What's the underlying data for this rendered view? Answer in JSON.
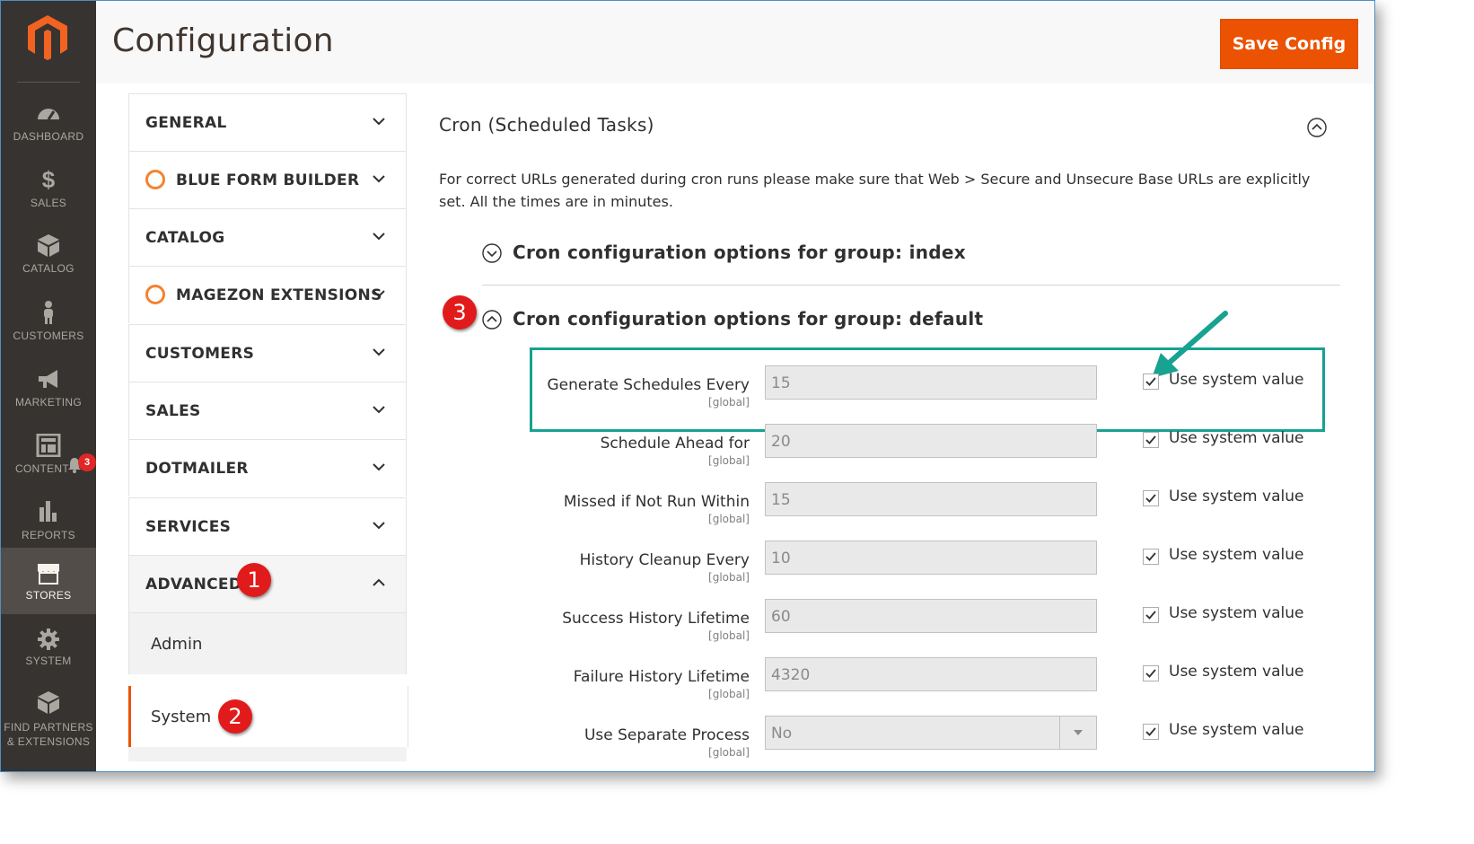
{
  "header": {
    "title": "Configuration",
    "save_label": "Save Config"
  },
  "sidebar": {
    "items": [
      {
        "label": "DASHBOARD",
        "icon": "dashboard-icon"
      },
      {
        "label": "SALES",
        "icon": "dollar-icon"
      },
      {
        "label": "CATALOG",
        "icon": "box-icon"
      },
      {
        "label": "CUSTOMERS",
        "icon": "person-icon"
      },
      {
        "label": "MARKETING",
        "icon": "megaphone-icon"
      },
      {
        "label": "CONTENT",
        "icon": "layout-icon",
        "notification_count": "3"
      },
      {
        "label": "REPORTS",
        "icon": "bar-chart-icon"
      },
      {
        "label": "STORES",
        "icon": "store-icon",
        "active": true
      },
      {
        "label": "SYSTEM",
        "icon": "gear-icon"
      },
      {
        "label_line1": "FIND PARTNERS",
        "label_line2": "& EXTENSIONS",
        "icon": "boxes-icon"
      }
    ]
  },
  "config_tabs": [
    {
      "label": "GENERAL"
    },
    {
      "label": "BLUE FORM BUILDER",
      "has_ring_icon": true
    },
    {
      "label": "CATALOG"
    },
    {
      "label": "MAGEZON EXTENSIONS",
      "has_ring_icon": true
    },
    {
      "label": "CUSTOMERS"
    },
    {
      "label": "SALES"
    },
    {
      "label": "DOTMAILER"
    },
    {
      "label": "SERVICES"
    },
    {
      "label": "ADVANCED",
      "expanded": true,
      "children": [
        {
          "label": "Admin"
        },
        {
          "label": "System",
          "current": true
        }
      ]
    }
  ],
  "steps": {
    "one": "1",
    "two": "2",
    "three": "3"
  },
  "section": {
    "title": "Cron (Scheduled Tasks)",
    "comment": "For correct URLs generated during cron runs please make sure that Web > Secure and Unsecure Base URLs are explicitly set. All the times are in minutes.",
    "groups": [
      {
        "title": "Cron configuration options for group: index",
        "expanded": false
      },
      {
        "title": "Cron configuration options for group: default",
        "expanded": true
      }
    ],
    "fields": [
      {
        "label": "Generate Schedules Every",
        "scope": "[global]",
        "value": "15",
        "use_system_label": "Use system value",
        "checked": true
      },
      {
        "label": "Schedule Ahead for",
        "scope": "[global]",
        "value": "20",
        "use_system_label": "Use system value",
        "checked": true
      },
      {
        "label": "Missed if Not Run Within",
        "scope": "[global]",
        "value": "15",
        "use_system_label": "Use system value",
        "checked": true
      },
      {
        "label": "History Cleanup Every",
        "scope": "[global]",
        "value": "10",
        "use_system_label": "Use system value",
        "checked": true
      },
      {
        "label": "Success History Lifetime",
        "scope": "[global]",
        "value": "60",
        "use_system_label": "Use system value",
        "checked": true
      },
      {
        "label": "Failure History Lifetime",
        "scope": "[global]",
        "value": "4320",
        "use_system_label": "Use system value",
        "checked": true
      },
      {
        "label": "Use Separate Process",
        "scope": "[global]",
        "value": "No",
        "type": "select",
        "use_system_label": "Use system value",
        "checked": true
      }
    ]
  },
  "colors": {
    "accent": "#eb5202",
    "highlight": "#17a292",
    "step_badge": "#e11b1b",
    "sidebar_bg": "#373330"
  }
}
